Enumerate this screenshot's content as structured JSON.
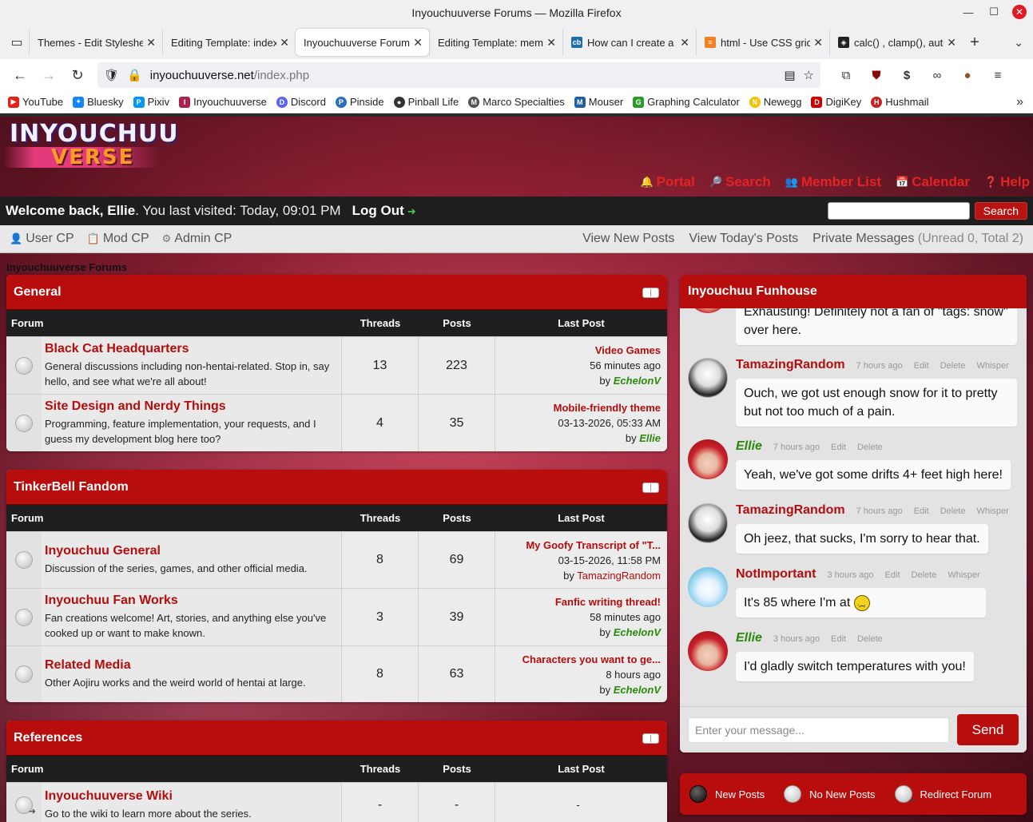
{
  "window": {
    "title": "Inyouchuuverse Forums — Mozilla Firefox"
  },
  "tabs": [
    {
      "label": "Themes - Edit Stylesheet",
      "favicon_color": "#ffffff",
      "active": false
    },
    {
      "label": "Editing Template: index",
      "favicon_color": "#ffffff",
      "active": false
    },
    {
      "label": "Inyouchuuverse Forums",
      "favicon_color": "#ffffff",
      "active": true
    },
    {
      "label": "Editing Template: member",
      "favicon_color": "#ffffff",
      "active": false
    },
    {
      "label": "How can I create a",
      "favicon_color": "#1b6fa8",
      "active": false
    },
    {
      "label": "html - Use CSS grid",
      "favicon_color": "#f48024",
      "active": false
    },
    {
      "label": "calc() , clamp(), auto",
      "favicon_color": "#222222",
      "active": false
    }
  ],
  "navbar": {
    "url_host": "inyouchuuverse.net",
    "url_path": "/index.php"
  },
  "bookmarks": [
    {
      "label": "YouTube",
      "color": "#e62117",
      "glyph": "▶"
    },
    {
      "label": "Bluesky",
      "color": "#1185fe",
      "glyph": "🦋"
    },
    {
      "label": "Pixiv",
      "color": "#0096fa",
      "glyph": "P"
    },
    {
      "label": "Inyouchuuverse",
      "color": "#a8244a",
      "glyph": "I"
    },
    {
      "label": "Discord",
      "color": "#5865f2",
      "glyph": "D"
    },
    {
      "label": "Pinside",
      "color": "#2a6fb8",
      "glyph": "P"
    },
    {
      "label": "Pinball Life",
      "color": "#333333",
      "glyph": "●"
    },
    {
      "label": "Marco Specialties",
      "color": "#555555",
      "glyph": "M"
    },
    {
      "label": "Mouser",
      "color": "#1f5fa8",
      "glyph": "M"
    },
    {
      "label": "Graphing Calculator",
      "color": "#2a9a2a",
      "glyph": "G"
    },
    {
      "label": "Newegg",
      "color": "#f5c200",
      "glyph": "N"
    },
    {
      "label": "DigiKey",
      "color": "#cc0000",
      "glyph": "D"
    },
    {
      "label": "Hushmail",
      "color": "#c81e1e",
      "glyph": "H"
    }
  ],
  "site": {
    "logo_top": "INYOUCHUU",
    "logo_bottom": "VERSE",
    "toplinks": [
      {
        "label": "Portal",
        "icon": "🔔"
      },
      {
        "label": "Search",
        "icon": "🔎"
      },
      {
        "label": "Member List",
        "icon": "👥"
      },
      {
        "label": "Calendar",
        "icon": "📅"
      },
      {
        "label": "Help",
        "icon": "❓"
      }
    ],
    "welcome_prefix": "Welcome back, ",
    "welcome_user": "Ellie",
    "welcome_suffix": ". You last visited: Today, 09:01 PM",
    "logout_label": "Log Out",
    "search_button": "Search",
    "panel_links": [
      {
        "label": "User CP",
        "icon": "👤"
      },
      {
        "label": "Mod CP",
        "icon": "📋"
      },
      {
        "label": "Admin CP",
        "icon": "⚙"
      }
    ],
    "view_new_posts": "View New Posts",
    "view_todays_posts": "View Today's Posts",
    "private_messages": "Private Messages",
    "pm_counts": "(Unread 0, Total 2)",
    "breadcrumb": "Inyouchuuverse Forums"
  },
  "columns": {
    "forum": "Forum",
    "threads": "Threads",
    "posts": "Posts",
    "last_post": "Last Post"
  },
  "categories": [
    {
      "name": "General",
      "forums": [
        {
          "name": "Black Cat Headquarters",
          "desc": "General discussions including non-hentai-related. Stop in, say hello, and see what we're all about!",
          "threads": "13",
          "posts": "223",
          "last_title": "Video Games",
          "last_time": "56 minutes ago",
          "by": "by ",
          "last_user": "EchelonV",
          "user_style": "green"
        },
        {
          "name": "Site Design and Nerdy Things",
          "desc": "Programming, feature implementation, your requests, and I guess my development blog here too?",
          "threads": "4",
          "posts": "35",
          "last_title": "Mobile-friendly theme",
          "last_time": "03-13-2026, 05:33 AM",
          "by": "by ",
          "last_user": "Ellie",
          "user_style": "green"
        }
      ]
    },
    {
      "name": "TinkerBell Fandom",
      "forums": [
        {
          "name": "Inyouchuu General",
          "desc": "Discussion of the series, games, and other official media.",
          "threads": "8",
          "posts": "69",
          "last_title": "My Goofy Transcript of \"T...",
          "last_time": "03-15-2026, 11:58 PM",
          "by": "by ",
          "last_user": "TamazingRandom",
          "user_style": "red"
        },
        {
          "name": "Inyouchuu Fan Works",
          "desc": "Fan creations welcome! Art, stories, and anything else you've cooked up or want to make known.",
          "threads": "3",
          "posts": "39",
          "last_title": "Fanfic writing thread!",
          "last_time": "58 minutes ago",
          "by": "by ",
          "last_user": "EchelonV",
          "user_style": "green"
        },
        {
          "name": "Related Media",
          "desc": "Other Aojiru works and the weird world of hentai at large.",
          "threads": "8",
          "posts": "63",
          "last_title": "Characters you want to ge...",
          "last_time": "8 hours ago",
          "by": "by ",
          "last_user": "EchelonV",
          "user_style": "green"
        }
      ]
    },
    {
      "name": "References",
      "forums": [
        {
          "name": "Inyouchuuverse Wiki",
          "desc": "Go to the wiki to learn more about the series.",
          "threads": "-",
          "posts": "-",
          "last_dash": "-"
        }
      ]
    }
  ],
  "chat": {
    "title": "Inyouchuu Funhouse",
    "edit_label": "Edit",
    "delete_label": "Delete",
    "whisper_label": "Whisper",
    "messages": [
      {
        "text": "Exhausting! Definitely not a fan of \"tags: snow\" over here."
      },
      {
        "user": "TamazingRandom",
        "time": "7 hours ago",
        "text": "Ouch, we got ust enough snow for it to pretty but not too much of a pain."
      },
      {
        "user": "Ellie",
        "time": "7 hours ago",
        "text": "Yeah, we've got some drifts 4+ feet high here!"
      },
      {
        "user": "TamazingRandom",
        "time": "7 hours ago",
        "text": "Oh jeez, that sucks, I'm sorry to hear that."
      },
      {
        "user": "NotImportant",
        "time": "3 hours ago",
        "text": "It's 85 where I'm at "
      },
      {
        "user": "Ellie",
        "time": "3 hours ago",
        "text": "I'd gladly switch temperatures with you!"
      }
    ],
    "input_placeholder": "Enter your message...",
    "send_label": "Send"
  },
  "legend": {
    "new_posts": "New Posts",
    "no_new_posts": "No New Posts",
    "redirect": "Redirect Forum"
  },
  "colors": {
    "accent": "#b80d0d",
    "link": "#b30d0d",
    "user_green": "#2a8a0a"
  }
}
